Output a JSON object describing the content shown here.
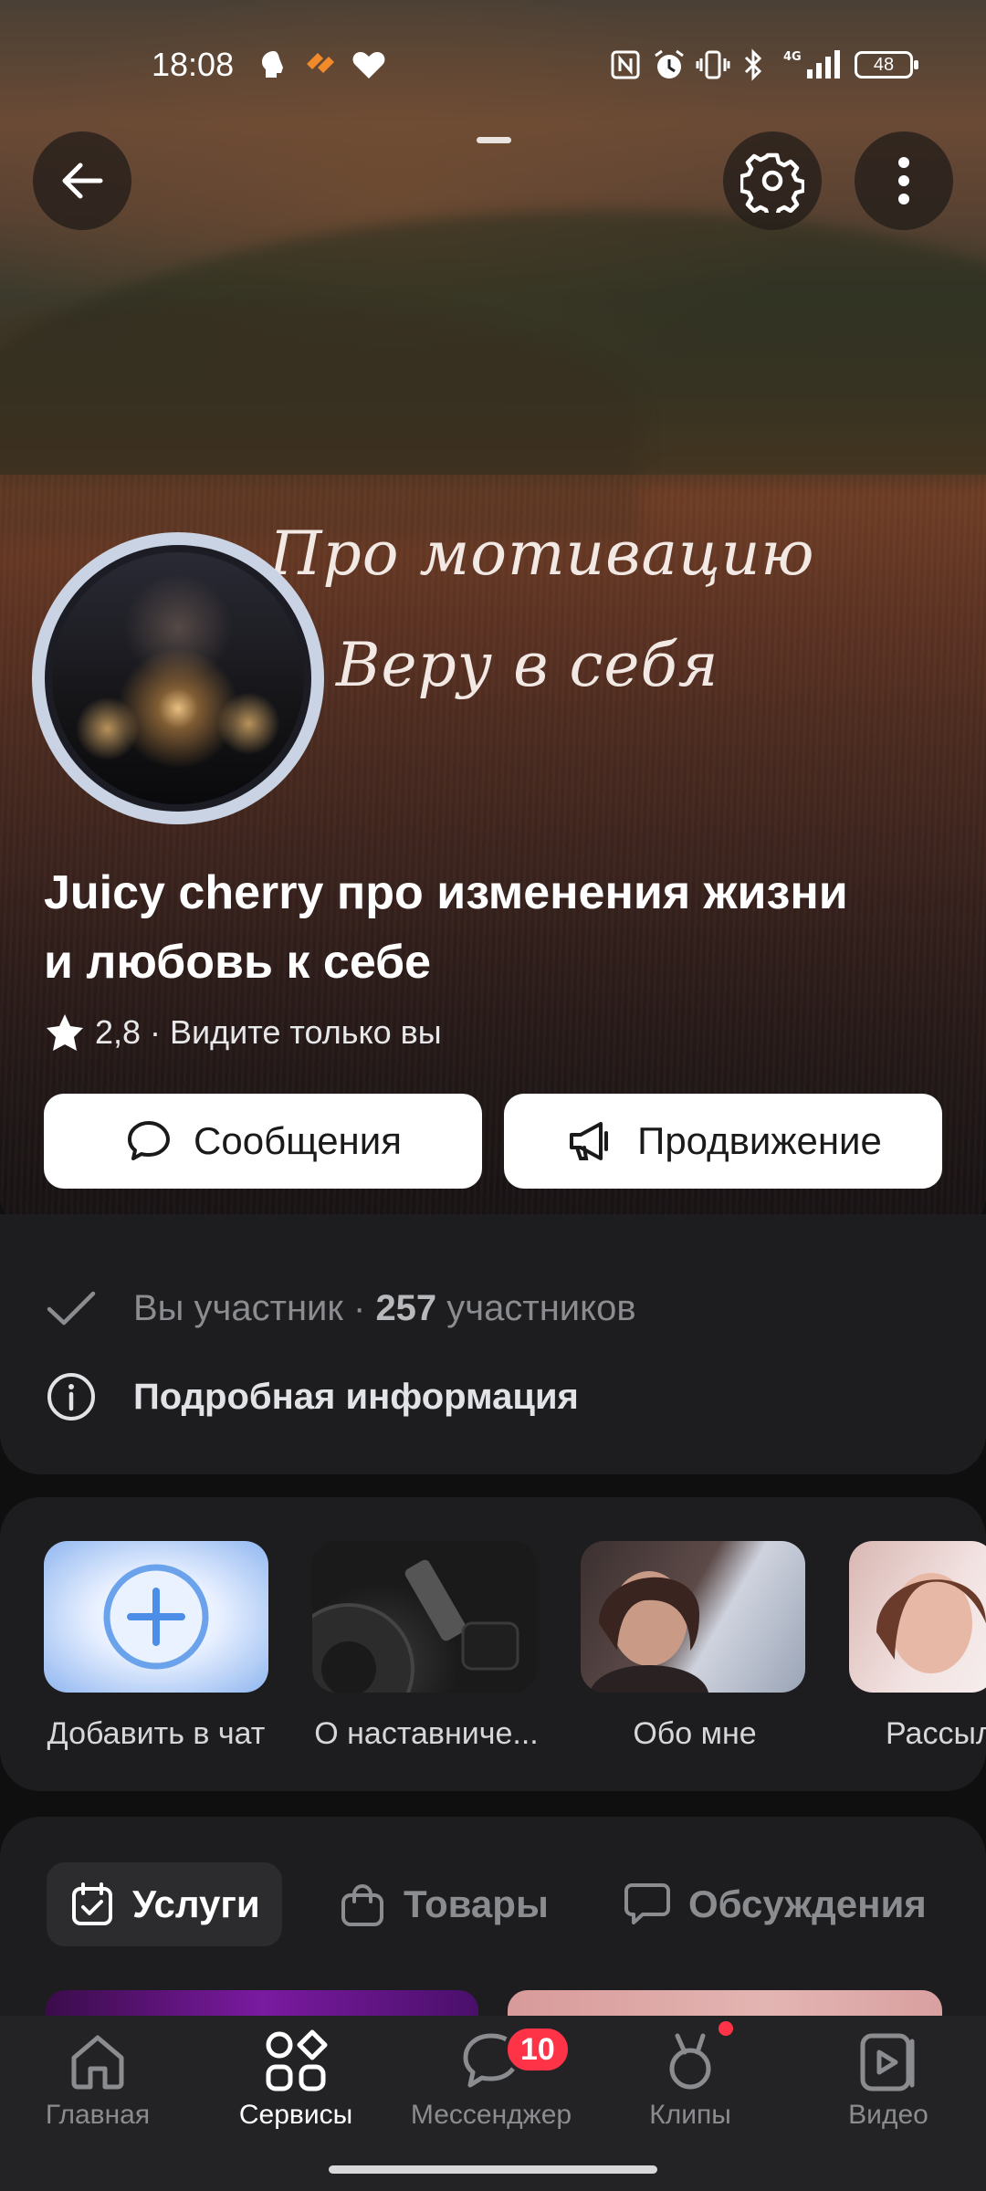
{
  "status_bar": {
    "time": "18:08",
    "battery": "48",
    "icons": [
      "brain-app-icon",
      "orange-heart-app-icon",
      "heart-icon",
      "nfc-icon",
      "alarm-icon",
      "vibrate-icon",
      "bluetooth-icon",
      "signal-4g-icon",
      "battery-icon"
    ]
  },
  "cover": {
    "text_line1": "Про мотивацию",
    "text_line2": "Веру в себя"
  },
  "header": {
    "back_icon": "arrow-left-icon",
    "settings_icon": "gear-icon",
    "more_icon": "more-vertical-icon"
  },
  "group": {
    "title": "Juicy cherry про изменения жизни и любовь к себе",
    "rating": "2,8",
    "visibility": "· Видите только вы"
  },
  "actions": {
    "messages_label": "Сообщения",
    "promotion_label": "Продвижение"
  },
  "info": {
    "member_text": "Вы участник · ",
    "member_count": "257",
    "member_suffix": " участников",
    "details_label": "Подробная информация"
  },
  "shortcuts": [
    {
      "label": "Добавить в чат"
    },
    {
      "label": "О наставниче..."
    },
    {
      "label": "Обо мне"
    },
    {
      "label": "Рассылк"
    }
  ],
  "tabs": [
    {
      "label": "Услуги",
      "active": true
    },
    {
      "label": "Товары",
      "active": false
    },
    {
      "label": "Обсуждения",
      "active": false
    }
  ],
  "bottom_nav": [
    {
      "label": "Главная",
      "icon": "home-icon",
      "active": false
    },
    {
      "label": "Сервисы",
      "icon": "services-grid-icon",
      "active": true
    },
    {
      "label": "Мессенджер",
      "icon": "chat-bubble-icon",
      "active": false,
      "badge": "10"
    },
    {
      "label": "Клипы",
      "icon": "clips-icon",
      "active": false
    },
    {
      "label": "Видео",
      "icon": "video-icon",
      "active": false
    }
  ],
  "colors": {
    "accent_blue": "#5a9cf0",
    "badge_red": "#ff3347",
    "card_bg": "#1d1d1f"
  }
}
